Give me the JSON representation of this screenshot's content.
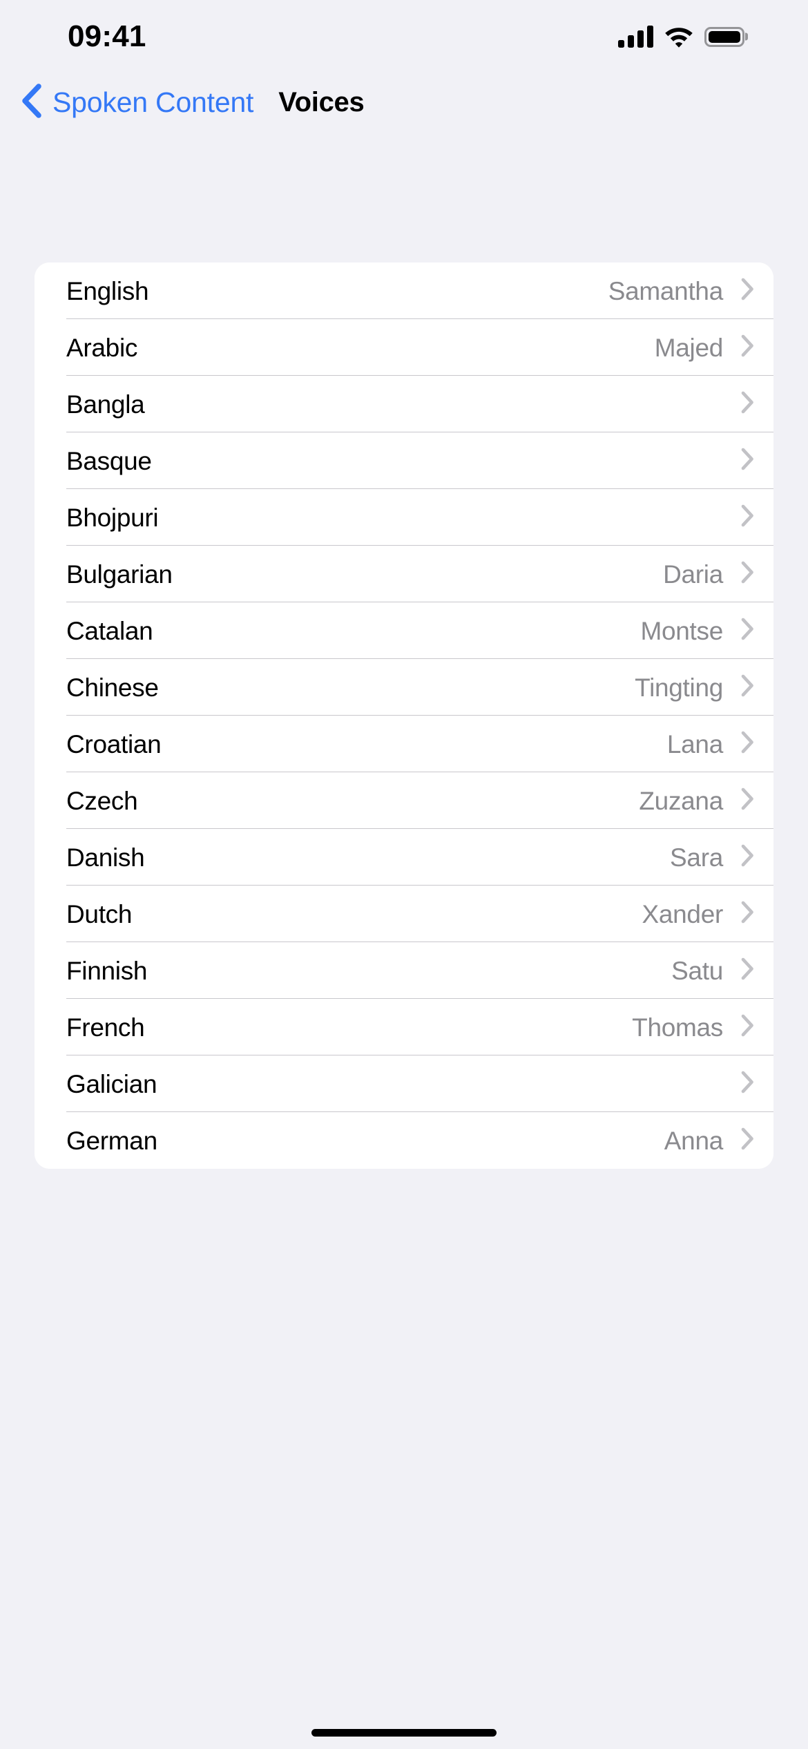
{
  "status_bar": {
    "time": "09:41",
    "cellular_icon": "cellular-signal-icon",
    "wifi_icon": "wifi-icon",
    "battery_icon": "battery-full-icon"
  },
  "nav": {
    "back_label": "Spoken Content",
    "back_icon": "chevron-left-icon",
    "title": "Voices"
  },
  "colors": {
    "accent_blue": "#3478f6",
    "background": "#f1f1f6",
    "card": "#ffffff",
    "separator": "#c8c7cc",
    "value_gray": "#8a8a8e"
  },
  "list": {
    "rows": [
      {
        "language": "English",
        "voice": "Samantha"
      },
      {
        "language": "Arabic",
        "voice": "Majed"
      },
      {
        "language": "Bangla",
        "voice": ""
      },
      {
        "language": "Basque",
        "voice": ""
      },
      {
        "language": "Bhojpuri",
        "voice": ""
      },
      {
        "language": "Bulgarian",
        "voice": "Daria"
      },
      {
        "language": "Catalan",
        "voice": "Montse"
      },
      {
        "language": "Chinese",
        "voice": "Tingting"
      },
      {
        "language": "Croatian",
        "voice": "Lana"
      },
      {
        "language": "Czech",
        "voice": "Zuzana"
      },
      {
        "language": "Danish",
        "voice": "Sara"
      },
      {
        "language": "Dutch",
        "voice": "Xander"
      },
      {
        "language": "Finnish",
        "voice": "Satu"
      },
      {
        "language": "French",
        "voice": "Thomas"
      },
      {
        "language": "Galician",
        "voice": ""
      },
      {
        "language": "German",
        "voice": "Anna"
      }
    ]
  }
}
